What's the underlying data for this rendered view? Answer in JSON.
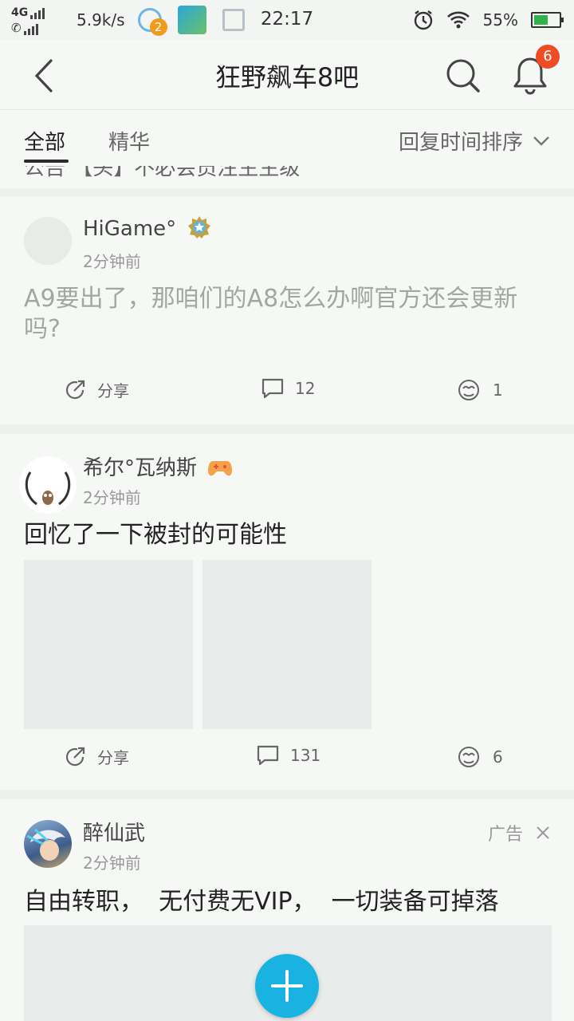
{
  "status_bar": {
    "network": "4G",
    "speed": "5.9k/s",
    "notif_count": "2",
    "time": "22:17",
    "battery": "55%"
  },
  "header": {
    "title": "狂野飙车8吧",
    "bell_badge": "6"
  },
  "tabs": {
    "all": "全部",
    "featured": "精华",
    "sort": "回复时间排序"
  },
  "peek_text": "公告 【头】不必会员注生生级",
  "posts": [
    {
      "author": "HiGame°",
      "time": "2分钟前",
      "text": "A9要出了，那咱们的A8怎么办啊官方还会更新吗?",
      "share_label": "分享",
      "comments": "12",
      "likes": "1"
    },
    {
      "author": "希尔°瓦纳斯",
      "time": "2分钟前",
      "text": "回忆了一下被封的可能性",
      "share_label": "分享",
      "comments": "131",
      "likes": "6"
    },
    {
      "author": "醉仙武",
      "time": "2分钟前",
      "ad_label": "广告",
      "text": "自由转职，  无付费无VIP，  一切装备可掉落"
    }
  ],
  "colors": {
    "accent_fab": "#1ab2e0",
    "badge": "#ef4c26",
    "background": "#f6f8f6"
  }
}
